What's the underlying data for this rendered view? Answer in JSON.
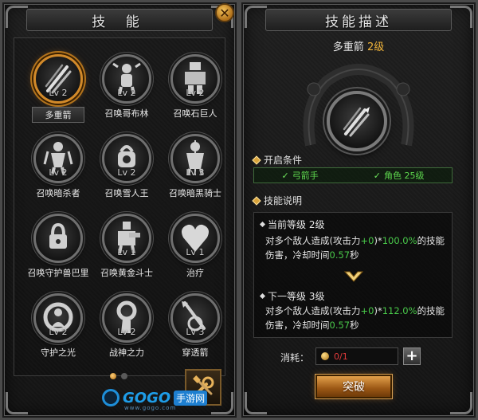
{
  "left_panel": {
    "title": "技  能",
    "skills": [
      {
        "name": "多重箭",
        "level": "Lv 2",
        "icon": "multi-arrow-icon",
        "selected": true
      },
      {
        "name": "召唤哥布林",
        "level": "Lv 2",
        "icon": "goblin-icon"
      },
      {
        "name": "召唤石巨人",
        "level": "Lv 2",
        "icon": "stone-giant-icon"
      },
      {
        "name": "召唤暗杀者",
        "level": "Lv 2",
        "icon": "assassin-icon"
      },
      {
        "name": "召唤雪人王",
        "level": "Lv 2",
        "icon": "yeti-king-icon"
      },
      {
        "name": "召唤暗黑骑士",
        "level": "Lv 3",
        "icon": "dark-knight-icon"
      },
      {
        "name": "召唤守护兽巴里",
        "level": "",
        "icon": "locked-guardian-icon"
      },
      {
        "name": "召唤黄金斗士",
        "level": "Lv 1",
        "icon": "golden-fighter-icon"
      },
      {
        "name": "治疗",
        "level": "Lv 1",
        "icon": "heal-heart-icon"
      },
      {
        "name": "守护之光",
        "level": "Lv 2",
        "icon": "guardian-light-icon"
      },
      {
        "name": "战神之力",
        "level": "Lv 2",
        "icon": "war-god-icon"
      },
      {
        "name": "穿透箭",
        "level": "Lv 3",
        "icon": "pierce-arrow-icon"
      }
    ],
    "page_indicator": {
      "current": 1,
      "total": 2
    },
    "settings_icon": "tools-icon"
  },
  "logo": {
    "brand": "GOGO",
    "suffix": "手游网",
    "url": "www.gogo.com"
  },
  "right_panel": {
    "title": "技能描述",
    "skill_name": "多重箭",
    "skill_level": "2级",
    "condition_title": "开启条件",
    "conditions": [
      {
        "label": "弓箭手"
      },
      {
        "label": "角色 25级"
      }
    ],
    "explain_title": "技能说明",
    "current_level": {
      "label": "当前等级 2级",
      "text_a": "对多个敌人造成(攻击力",
      "num_a": "+0",
      "text_b": ")*",
      "num_b": "100.0%",
      "text_c": "的技能伤害，冷却时间",
      "num_c": "0.57",
      "text_d": "秒"
    },
    "next_level": {
      "label": "下一等级 3级",
      "text_a": "对多个敌人造成(攻击力",
      "num_a": "+0",
      "text_b": ")*",
      "num_b": "112.0%",
      "text_c": "的技能伤害，冷却时间",
      "num_c": "0.57",
      "text_d": "秒"
    },
    "cost_label": "消耗：",
    "cost_value": "0/1",
    "plus_label": "+",
    "breakthrough_label": "突破"
  },
  "colors": {
    "accent_gold": "#d9a43c",
    "value_green": "#49c94a",
    "cost_red": "#e23b3b"
  }
}
